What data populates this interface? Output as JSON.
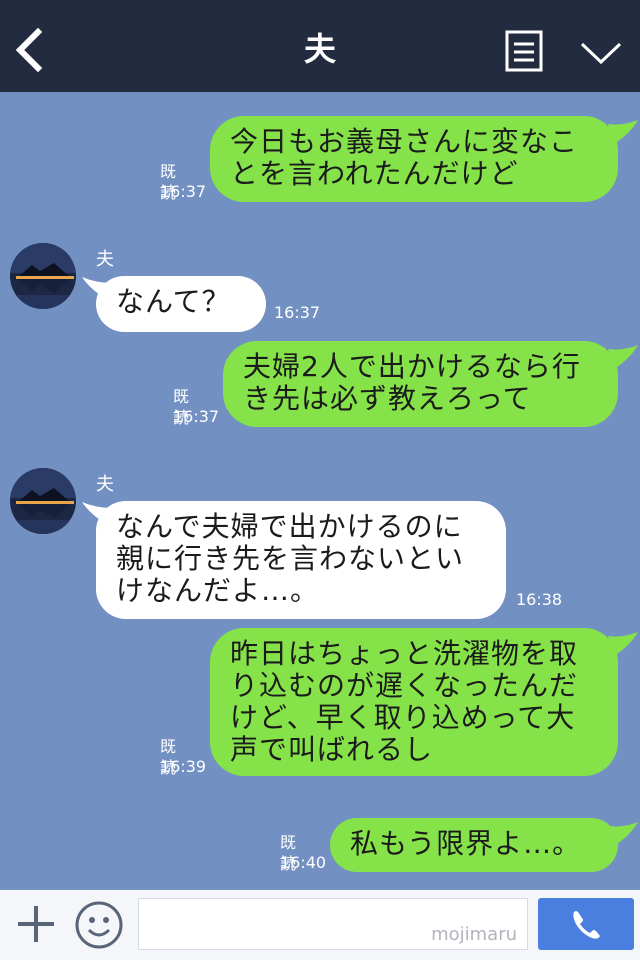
{
  "header": {
    "title": "夫",
    "bg_color": "#232b40"
  },
  "chat": {
    "bg_color": "#7390c2",
    "messages": [
      {
        "side": "right",
        "text": "今日もお義母さんに変なこ\nとを言われたんだけど",
        "read": "既読",
        "time": "16:37"
      },
      {
        "side": "left",
        "sender": "夫",
        "text": "なんて？",
        "time": "16:37"
      },
      {
        "side": "right",
        "text": "夫婦2人で出かけるなら行\nき先は必ず教えろって",
        "read": "既読",
        "time": "16:37"
      },
      {
        "side": "left",
        "sender": "夫",
        "text": "なんで夫婦で出かけるのに\n親に行き先を言わないとい\nけなんだよ…。",
        "time": "16:38"
      },
      {
        "side": "right",
        "text": "昨日はちょっと洗濯物を取\nり込むのが遅くなったんだ\nけど、早く取り込めって大\n声で叫ばれるし",
        "read": "既読",
        "time": "16:39"
      },
      {
        "side": "right",
        "text": "私もう限界よ…。",
        "read": "既読",
        "time": "16:40"
      }
    ]
  },
  "colors": {
    "green_bubble": "#85e249",
    "white_bubble": "#ffffff",
    "send_button": "#4a7fe0"
  },
  "footer": {
    "input_value": "",
    "watermark": "mojimaru"
  },
  "icons": {
    "back": "chevron-left-icon",
    "menu": "document-lines-icon",
    "collapse": "chevron-down-icon",
    "add": "plus-icon",
    "emoji": "smiley-icon",
    "call": "phone-icon"
  }
}
